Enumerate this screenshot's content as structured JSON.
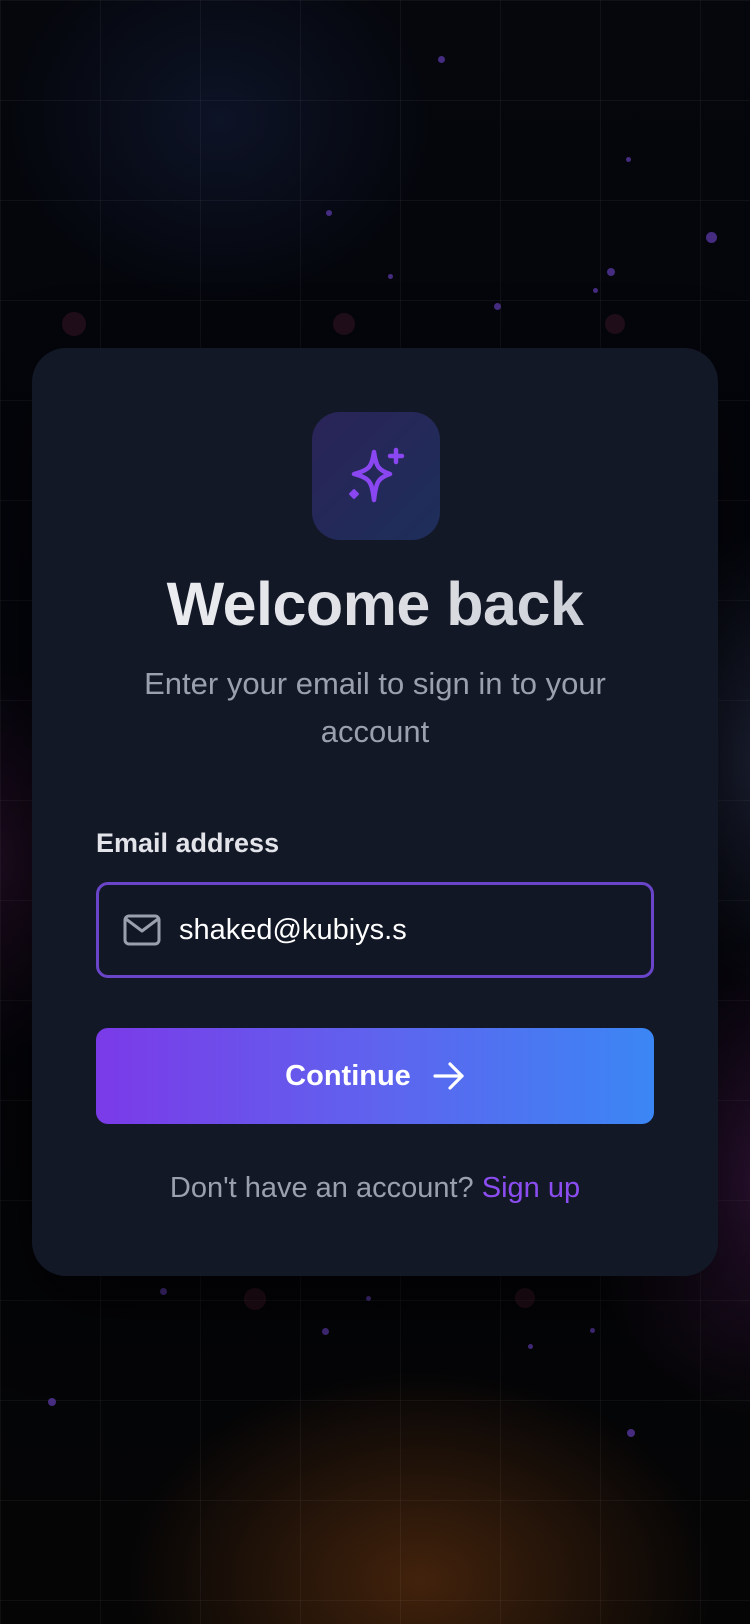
{
  "auth": {
    "title": "Welcome back",
    "subtitle": "Enter your email to sign in to your account",
    "email_label": "Email address",
    "email_value": "shaked@kubiys.s",
    "continue_label": "Continue",
    "signup_prompt": "Don't have an account?",
    "signup_link": "Sign up"
  },
  "icons": {
    "logo": "sparkles-icon",
    "email": "mail-icon",
    "continue": "arrow-right-icon"
  },
  "colors": {
    "accent": "#7b3ae8",
    "accent_end": "#3b86f5",
    "link": "#8b4cf0",
    "card_bg": "#131827",
    "input_border": "#6a45c9"
  }
}
